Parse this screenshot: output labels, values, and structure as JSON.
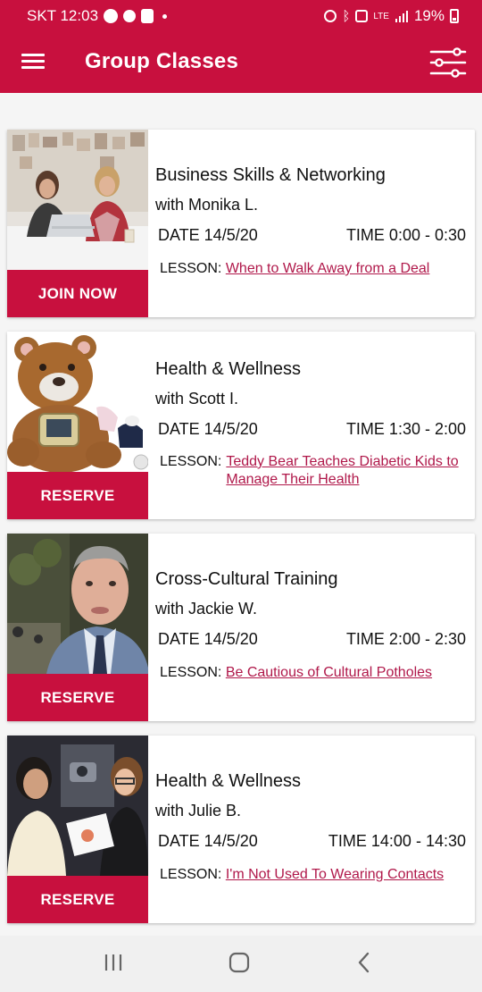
{
  "status_bar": {
    "carrier_time": "SKT 12:03",
    "network": "LTE",
    "battery": "19%"
  },
  "app_bar": {
    "title": "Group Classes",
    "menu_icon": "hamburger-menu-icon",
    "filter_icon": "sliders-filter-icon"
  },
  "colors": {
    "brand": "#c8103e",
    "link": "#b0184a"
  },
  "classes": [
    {
      "category": "Business Skills & Networking",
      "instructor": "with Monika L.",
      "date": "DATE 14/5/20",
      "time": "TIME 0:00 - 0:30",
      "lesson_label": "LESSON:",
      "lesson_title": "When to Walk Away from a Deal",
      "button": "JOIN NOW",
      "image": "two-women-with-laptops-photo"
    },
    {
      "category": "Health & Wellness",
      "instructor": "with Scott I.",
      "date": "DATE 14/5/20",
      "time": "TIME 1:30 - 2:00",
      "lesson_label": "LESSON:",
      "lesson_title": "Teddy Bear Teaches Diabetic Kids to Manage Their Health",
      "button": "RESERVE",
      "image": "teddy-bear-photo"
    },
    {
      "category": "Cross-Cultural Training",
      "instructor": "with Jackie W.",
      "date": "DATE 14/5/20",
      "time": "TIME 2:00 - 2:30",
      "lesson_label": "LESSON:",
      "lesson_title": "Be Cautious of Cultural Potholes",
      "button": "RESERVE",
      "image": "man-in-suit-photo"
    },
    {
      "category": "Health & Wellness",
      "instructor": "with Julie B.",
      "date": "DATE 14/5/20",
      "time": "TIME 14:00 - 14:30",
      "lesson_label": "LESSON:",
      "lesson_title": "I'm Not Used To Wearing Contacts",
      "button": "RESERVE",
      "image": "optometrist-and-patient-photo"
    }
  ],
  "nav_bar": {
    "recents_icon": "recent-apps-icon",
    "home_icon": "home-icon",
    "back_icon": "back-icon"
  }
}
